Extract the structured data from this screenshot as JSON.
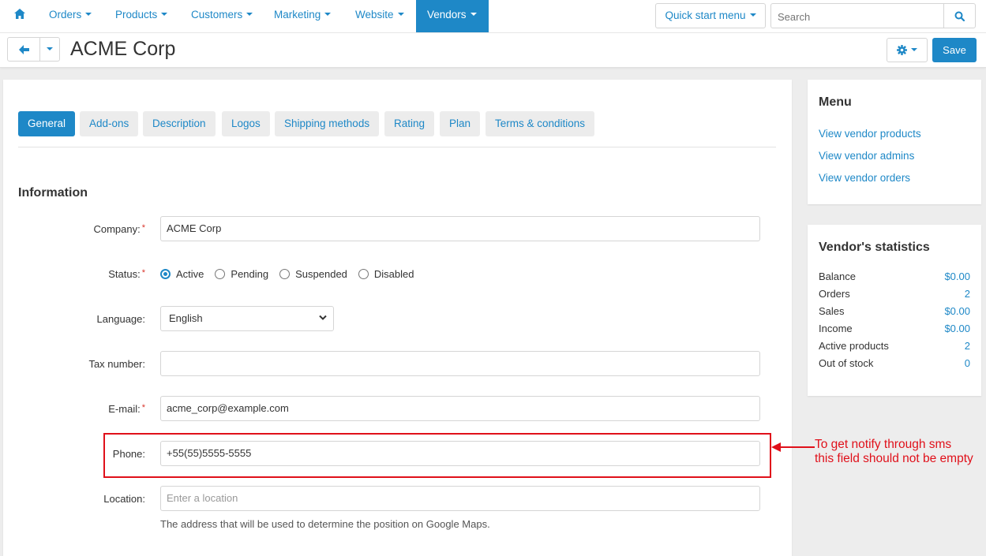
{
  "nav": {
    "home_icon": "home-icon",
    "items": [
      "Orders",
      "Products",
      "Customers",
      "Marketing",
      "Website",
      "Vendors"
    ],
    "active": "Vendors",
    "quick_start": "Quick start menu",
    "search_placeholder": "Search"
  },
  "header": {
    "title": "ACME Corp",
    "save_label": "Save"
  },
  "tabs": [
    "General",
    "Add-ons",
    "Description",
    "Logos",
    "Shipping methods",
    "Rating",
    "Plan",
    "Terms & conditions"
  ],
  "form": {
    "section_title": "Information",
    "company_label": "Company:",
    "company_value": "ACME Corp",
    "status_label": "Status:",
    "status_options": [
      "Active",
      "Pending",
      "Suspended",
      "Disabled"
    ],
    "status_selected": "Active",
    "language_label": "Language:",
    "language_value": "English",
    "tax_label": "Tax number:",
    "tax_value": "",
    "email_label": "E-mail:",
    "email_value": "acme_corp@example.com",
    "phone_label": "Phone:",
    "phone_value": "+55(55)5555-5555",
    "location_label": "Location:",
    "location_placeholder": "Enter a location",
    "location_hint": "The address that will be used to determine the position on Google Maps."
  },
  "annotation": {
    "line1": "To get notify through sms",
    "line2": "this field should not be empty",
    "color": "#e0101a"
  },
  "sidebar": {
    "menu_title": "Menu",
    "menu_links": [
      "View vendor products",
      "View vendor admins",
      "View vendor orders"
    ],
    "stats_title": "Vendor's statistics",
    "stats": [
      {
        "label": "Balance",
        "value": "$0.00"
      },
      {
        "label": "Orders",
        "value": "2"
      },
      {
        "label": "Sales",
        "value": "$0.00"
      },
      {
        "label": "Income",
        "value": "$0.00"
      },
      {
        "label": "Active products",
        "value": "2"
      },
      {
        "label": "Out of stock",
        "value": "0"
      }
    ]
  },
  "colors": {
    "accent": "#1e88c7",
    "background": "#ededed",
    "required": "#d9352b"
  }
}
